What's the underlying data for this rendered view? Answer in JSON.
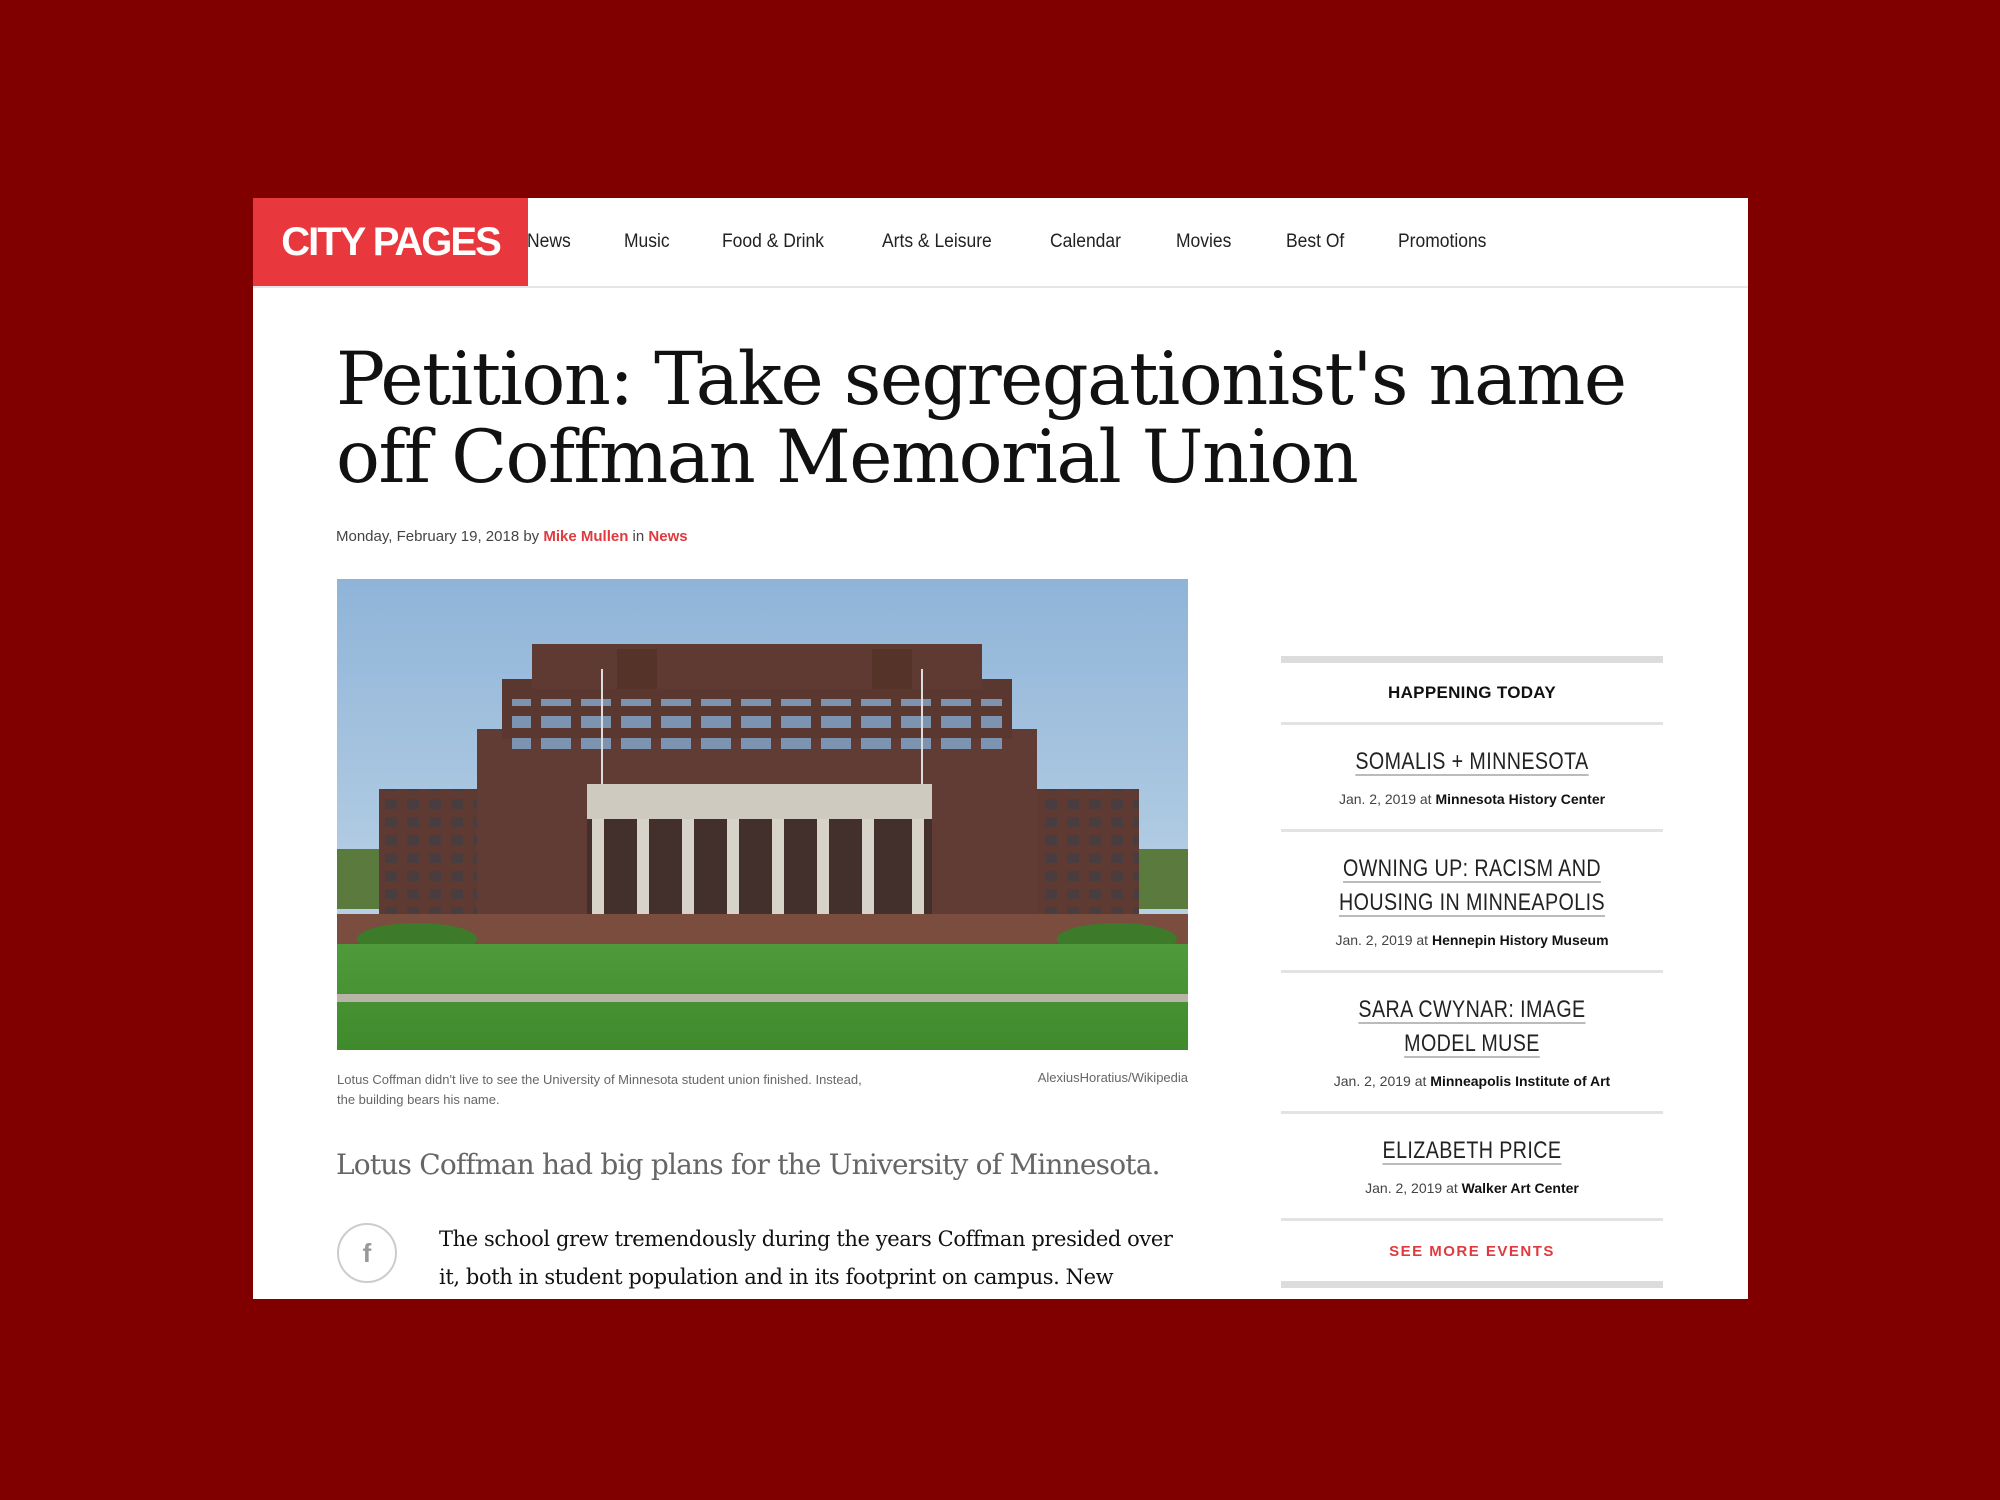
{
  "header": {
    "logo": "CITY PAGES",
    "nav": [
      "News",
      "Music",
      "Food & Drink",
      "Arts & Leisure",
      "Calendar",
      "Movies",
      "Best Of",
      "Promotions"
    ]
  },
  "article": {
    "headline": "Petition: Take segregationist's name off Coffman Memorial Union",
    "date": "Monday, February 19, 2018",
    "by": "by",
    "author": "Mike Mullen",
    "in": "in",
    "section": "News",
    "caption": "Lotus Coffman didn't live to see the University of Minnesota student union finished. Instead, the building bears his name.",
    "credit": "AlexiusHoratius/Wikipedia",
    "lede": "Lotus Coffman had big plans for the University of Minnesota.",
    "body": "The school grew tremendously during the years Coffman presided over it, both in student population and in its footprint on campus. New",
    "share_icon": "facebook-icon"
  },
  "sidebar": {
    "title": "HAPPENING TODAY",
    "events": [
      {
        "title": "SOMALIS + MINNESOTA",
        "date": "Jan. 2, 2019",
        "at": "at",
        "venue": "Minnesota History Center"
      },
      {
        "title": "OWNING UP: RACISM AND HOUSING IN MINNEAPOLIS",
        "date": "Jan. 2, 2019",
        "at": "at",
        "venue": "Hennepin History Museum"
      },
      {
        "title": "SARA CWYNAR: IMAGE MODEL MUSE",
        "date": "Jan. 2, 2019",
        "at": "at",
        "venue": "Minneapolis Institute of Art"
      },
      {
        "title": "ELIZABETH PRICE",
        "date": "Jan. 2, 2019",
        "at": "at",
        "venue": "Walker Art Center"
      }
    ],
    "see_more": "SEE MORE EVENTS"
  },
  "colors": {
    "background": "#800000",
    "brand_red": "#e8383d",
    "link_red": "#e03a3e"
  }
}
